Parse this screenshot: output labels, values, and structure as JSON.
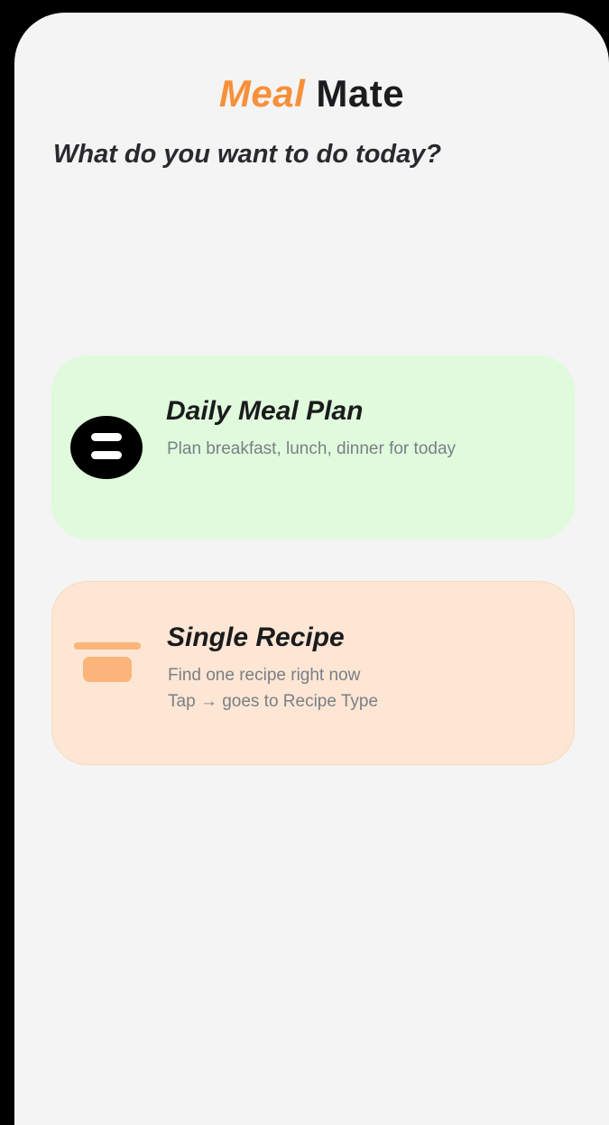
{
  "app": {
    "title_part_a": "Meal",
    "title_part_b": "Mate",
    "accent_color": "#f7903a"
  },
  "prompt": {
    "text": "What do you want to do today?"
  },
  "cards": [
    {
      "title": "Daily Meal Plan",
      "lines": [
        "Plan breakfast, lunch, dinner for today"
      ],
      "icon": "meal-plan-icon",
      "background": "#dffbdc"
    },
    {
      "title": "Single Recipe",
      "lines": [
        "Find one recipe right now",
        "Tap → goes to Recipe Type"
      ],
      "icon": "recipe-bowl-icon",
      "background": "#fde6d4"
    }
  ]
}
